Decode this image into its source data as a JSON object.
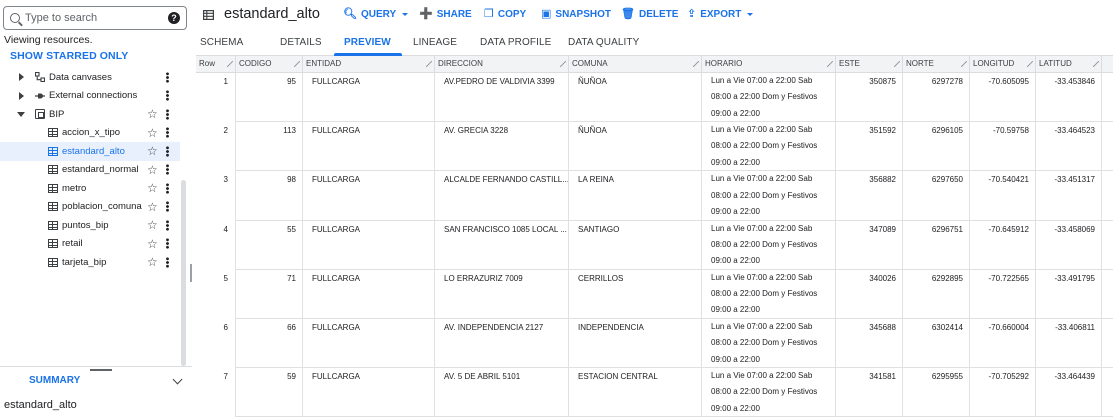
{
  "search": {
    "placeholder": "Type to search"
  },
  "sidebar": {
    "viewing_text": "Viewing resources.",
    "starred_label": "SHOW STARRED ONLY",
    "tree": [
      {
        "label": "Data canvases",
        "icon": "data-canvas-icon",
        "kind": "folder"
      },
      {
        "label": "External connections",
        "icon": "external-connection-icon",
        "kind": "folder"
      },
      {
        "label": "BIP",
        "icon": "dataset-icon",
        "kind": "dataset"
      }
    ],
    "tables": [
      {
        "label": "accion_x_tipo",
        "selected": false
      },
      {
        "label": "estandard_alto",
        "selected": true
      },
      {
        "label": "estandard_normal",
        "selected": false
      },
      {
        "label": "metro",
        "selected": false
      },
      {
        "label": "poblacion_comuna",
        "selected": false
      },
      {
        "label": "puntos_bip",
        "selected": false
      },
      {
        "label": "retail",
        "selected": false
      },
      {
        "label": "tarjeta_bip",
        "selected": false
      }
    ],
    "summary_label": "SUMMARY",
    "summary_title": "estandard_alto"
  },
  "toolbar": {
    "title": "estandard_alto",
    "query": "QUERY",
    "share": "SHARE",
    "copy": "COPY",
    "snapshot": "SNAPSHOT",
    "delete": "DELETE",
    "export": "EXPORT"
  },
  "tabs": [
    "SCHEMA",
    "DETAILS",
    "PREVIEW",
    "LINEAGE",
    "DATA PROFILE",
    "DATA QUALITY"
  ],
  "active_tab": "PREVIEW",
  "accent_color": "#1a73e8",
  "table": {
    "headers": [
      "Row",
      "CODIGO",
      "ENTIDAD",
      "DIRECCION",
      "COMUNA",
      "HORARIO",
      "ESTE",
      "NORTE",
      "LONGITUD",
      "LATITUD"
    ],
    "rows": [
      {
        "row": "1",
        "codigo": "95",
        "entidad": "FULLCARGA",
        "direccion": "AV.PEDRO DE VALDIVIA 3399",
        "comuna": "ÑUÑOA",
        "horario": "Lun a Vie 07:00 a 22:00 Sab 08:00 a 22:00 Dom y Festivos 09:00 a 22:00",
        "este": "350875",
        "norte": "6297278",
        "longitud": "-70.605095",
        "latitud": "-33.453846"
      },
      {
        "row": "2",
        "codigo": "113",
        "entidad": "FULLCARGA",
        "direccion": "AV. GRECIA 3228",
        "comuna": "ÑUÑOA",
        "horario": "Lun a Vie 07:00 a 22:00 Sab 08:00 a 22:00 Dom y Festivos 09:00 a 22:00",
        "este": "351592",
        "norte": "6296105",
        "longitud": "-70.59758",
        "latitud": "-33.464523"
      },
      {
        "row": "3",
        "codigo": "98",
        "entidad": "FULLCARGA",
        "direccion": "ALCALDE FERNANDO CASTILL...",
        "comuna": "LA REINA",
        "horario": "Lun a Vie 07:00 a 22:00 Sab 08:00 a 22:00 Dom y Festivos 09:00 a 22:00",
        "este": "356882",
        "norte": "6297650",
        "longitud": "-70.540421",
        "latitud": "-33.451317"
      },
      {
        "row": "4",
        "codigo": "55",
        "entidad": "FULLCARGA",
        "direccion": "SAN FRANCISCO 1085 LOCAL ...",
        "comuna": "SANTIAGO",
        "horario": "Lun a Vie 07:00 a 22:00 Sab 08:00 a 22:00 Dom y Festivos 09:00 a 22:00",
        "este": "347089",
        "norte": "6296751",
        "longitud": "-70.645912",
        "latitud": "-33.458069"
      },
      {
        "row": "5",
        "codigo": "71",
        "entidad": "FULLCARGA",
        "direccion": "LO ERRAZURIZ 7009",
        "comuna": "CERRILLOS",
        "horario": "Lun a Vie 07:00 a 22:00 Sab 08:00 a 22:00 Dom y Festivos 09:00 a 22:00",
        "este": "340026",
        "norte": "6292895",
        "longitud": "-70.722565",
        "latitud": "-33.491795"
      },
      {
        "row": "6",
        "codigo": "66",
        "entidad": "FULLCARGA",
        "direccion": "AV. INDEPENDENCIA 2127",
        "comuna": "INDEPENDENCIA",
        "horario": "Lun a Vie 07:00 a 22:00 Sab 08:00 a 22:00 Dom y Festivos 09:00 a 22:00",
        "este": "345688",
        "norte": "6302414",
        "longitud": "-70.660004",
        "latitud": "-33.406811"
      },
      {
        "row": "7",
        "codigo": "59",
        "entidad": "FULLCARGA",
        "direccion": "AV. 5 DE ABRIL 5101",
        "comuna": "ESTACION CENTRAL",
        "horario": "Lun a Vie 07:00 a 22:00 Sab 08:00 a 22:00 Dom y Festivos 09:00 a 22:00",
        "este": "341581",
        "norte": "6295955",
        "longitud": "-70.705292",
        "latitud": "-33.464439"
      }
    ]
  }
}
